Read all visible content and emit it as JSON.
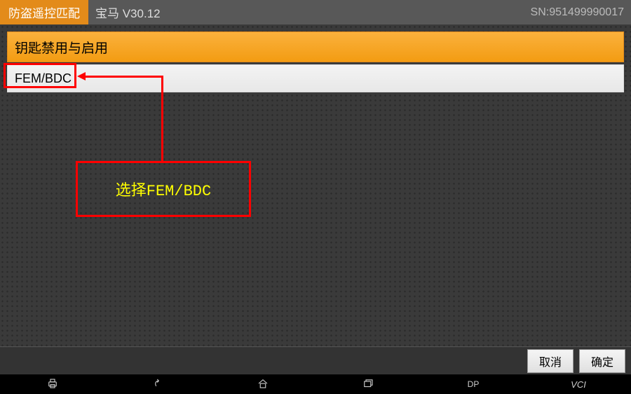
{
  "header": {
    "title": "防盗遥控匹配",
    "vehicle": "宝马  V30.12",
    "sn": "SN:951499990017"
  },
  "panel": {
    "heading": "钥匙禁用与启用",
    "items": [
      "FEM/BDC"
    ]
  },
  "annotation": {
    "label": "选择FEM/BDC"
  },
  "buttons": {
    "cancel": "取消",
    "ok": "确定"
  },
  "nav": {
    "dp": "DP",
    "vci": "VCI"
  }
}
